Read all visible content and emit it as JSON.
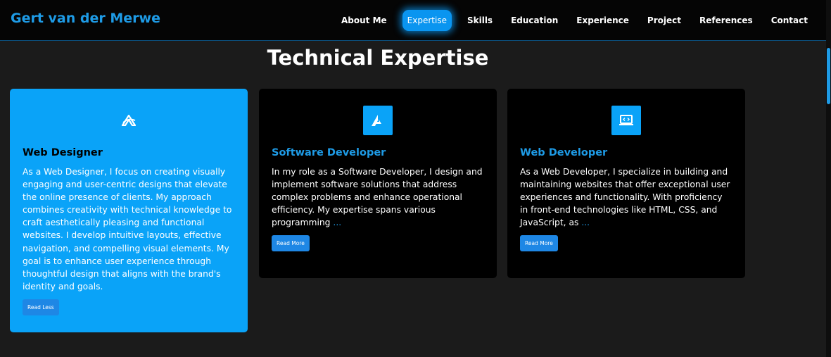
{
  "brand": "Gert van der Merwe",
  "nav": {
    "items": [
      {
        "label": "About Me"
      },
      {
        "label": "Expertise"
      },
      {
        "label": "Skills"
      },
      {
        "label": "Education"
      },
      {
        "label": "Experience"
      },
      {
        "label": "Project"
      },
      {
        "label": "References"
      },
      {
        "label": "Contact"
      }
    ],
    "active": "Expertise"
  },
  "section": {
    "title": "Technical Expertise"
  },
  "cards": [
    {
      "icon": "web-designer-logo-icon",
      "title": "Web Designer",
      "text": "As a Web Designer, I focus on creating visually engaging and user-centric designs that elevate the online presence of clients. My approach combines creativity with technical knowledge to craft aesthetically pleasing and functional websites. I develop intuitive layouts, effective navigation, and compelling visual elements. My goal is to enhance user experience through thoughtful design that aligns with the brand's identity and goals.",
      "ellipsis": "",
      "button": "Read Less"
    },
    {
      "icon": "software-developer-icon",
      "title": "Software Developer",
      "text": "In my role as a Software Developer, I design and implement software solutions that address complex problems and enhance operational efficiency. My expertise spans various programming",
      "ellipsis": "...",
      "button": "Read More"
    },
    {
      "icon": "code-monitor-icon",
      "title": "Web Developer",
      "text": "As a Web Developer, I specialize in building and maintaining websites that offer exceptional user experiences and functionality. With proficiency in front-end technologies like HTML, CSS, and JavaScript, as",
      "ellipsis": "...",
      "button": "Read More"
    }
  ],
  "colors": {
    "accent": "#1e9be6",
    "active_card": "#0aa3f8",
    "button": "#1e87e5",
    "background": "#1b1b1b"
  }
}
